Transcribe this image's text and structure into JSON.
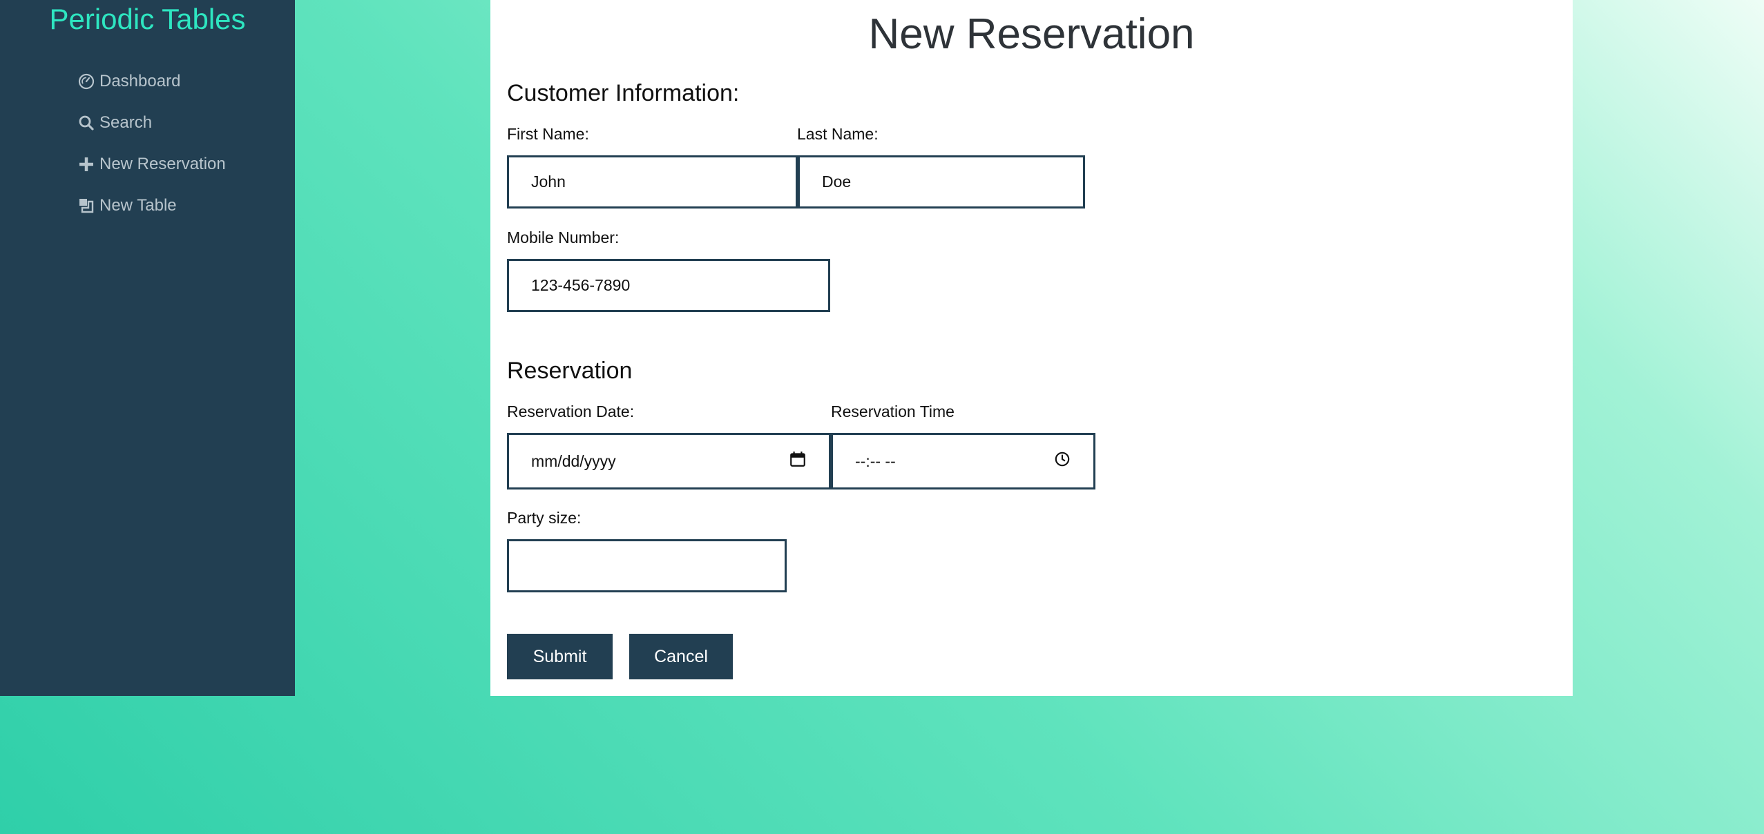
{
  "app": {
    "brand": "Periodic Tables"
  },
  "sidebar": {
    "items": [
      {
        "label": "Dashboard",
        "icon": "dashboard-icon"
      },
      {
        "label": "Search",
        "icon": "search-icon"
      },
      {
        "label": "New Reservation",
        "icon": "plus-icon"
      },
      {
        "label": "New Table",
        "icon": "table-icon"
      }
    ]
  },
  "page": {
    "title": "New Reservation"
  },
  "customer": {
    "heading": "Customer Information:",
    "first_name": {
      "label": "First Name:",
      "value": "John"
    },
    "last_name": {
      "label": "Last Name:",
      "value": "Doe"
    },
    "mobile": {
      "label": "Mobile Number:",
      "value": "123-456-7890"
    }
  },
  "reservation": {
    "heading": "Reservation",
    "date": {
      "label": "Reservation Date:",
      "placeholder": "mm/dd/yyyy"
    },
    "time": {
      "label": "Reservation Time",
      "placeholder": "--:-- --"
    },
    "party": {
      "label": "Party size:",
      "value": ""
    }
  },
  "actions": {
    "submit": "Submit",
    "cancel": "Cancel"
  },
  "colors": {
    "sidebar_bg": "#223f52",
    "brand": "#2ee6c1",
    "button_bg": "#223f52",
    "border": "#223f52"
  }
}
